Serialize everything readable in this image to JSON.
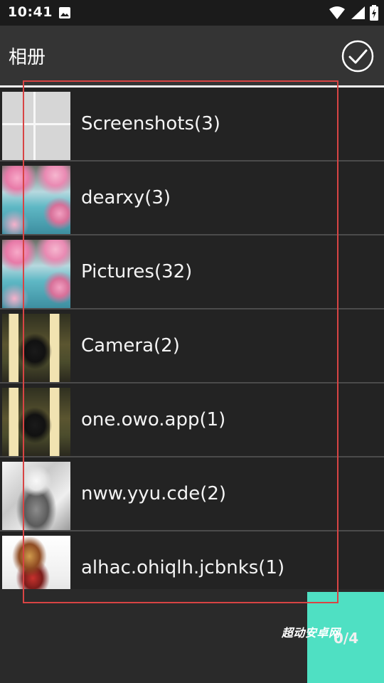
{
  "status_bar": {
    "time": "10:41",
    "icons": [
      "photo-icon",
      "wifi-icon",
      "cellular-signal-icon",
      "battery-charging-icon"
    ]
  },
  "app_bar": {
    "title": "相册",
    "confirm_icon": "check-circle-icon"
  },
  "albums": [
    {
      "name": "Screenshots(3)",
      "thumbnail": "screenshot-grid"
    },
    {
      "name": "dearxy(3)",
      "thumbnail": "cherry-blossom-lake"
    },
    {
      "name": "Pictures(32)",
      "thumbnail": "cherry-blossom-lake"
    },
    {
      "name": "Camera(2)",
      "thumbnail": "woman-on-sofa"
    },
    {
      "name": "one.owo.app(1)",
      "thumbnail": "woman-on-sofa"
    },
    {
      "name": "nww.yyu.cde(2)",
      "thumbnail": "manga-one-punch-man"
    },
    {
      "name": "alhac.ohiqlh.jcbnks(1)",
      "thumbnail": "anime-luffy"
    }
  ],
  "selection": {
    "count_label": "0/4"
  },
  "watermark": "超动安卓网",
  "colors": {
    "accent": "#4fe0c3",
    "app_bar": "#343434",
    "list_bg": "#232323",
    "highlight": "#d84444"
  }
}
